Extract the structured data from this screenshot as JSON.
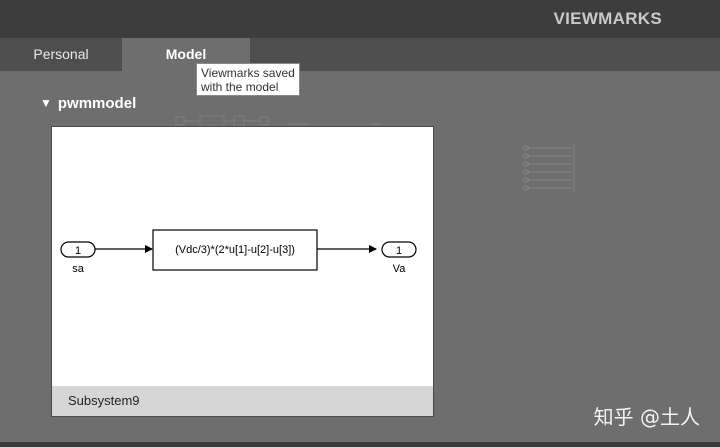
{
  "header": {
    "title": "VIEWMARKS"
  },
  "tabs": [
    {
      "label": "Personal",
      "active": false
    },
    {
      "label": "Model",
      "active": true
    }
  ],
  "tooltip": {
    "line1": "Viewmarks saved",
    "line2": "with the model"
  },
  "section": {
    "arrow": "▼",
    "title": "pwmmodel"
  },
  "viewmark_card": {
    "diagram": {
      "inport": {
        "number": "1",
        "name": "sa"
      },
      "fcn_block": {
        "expression": "(Vdc/3)*(2*u[1]-u[2]-u[3])"
      },
      "outport": {
        "number": "1",
        "name": "Va"
      }
    },
    "footer_label": "Subsystem9"
  },
  "watermark": "知乎 @土人",
  "colors": {
    "title_bar": "#3d3d3d",
    "tab_bar": "#4e4e4e",
    "content_bg": "#6e6e6e",
    "card_footer": "#d6d6d6"
  }
}
